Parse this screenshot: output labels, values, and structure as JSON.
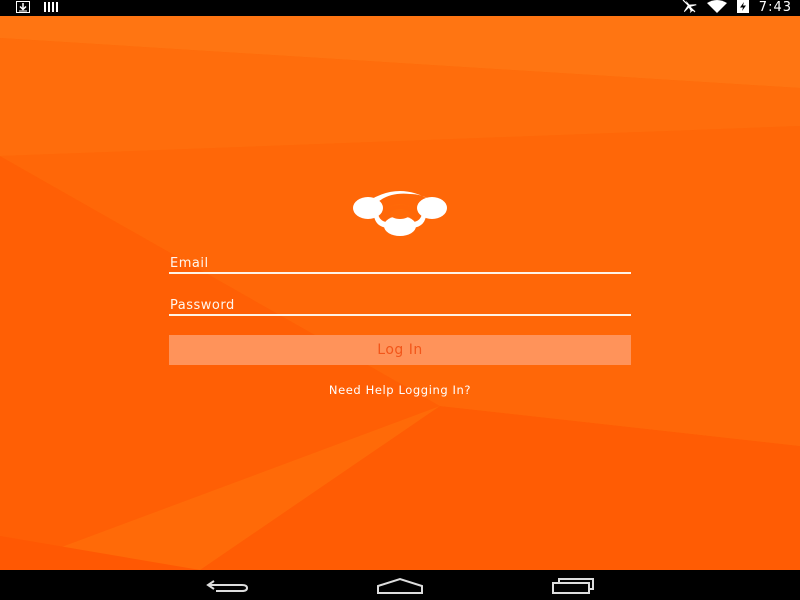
{
  "status_bar": {
    "time": "7:43",
    "left_icons": [
      "download-icon",
      "signal-bars-icon"
    ],
    "right_icons": [
      "airplane-mode-icon",
      "wifi-icon",
      "battery-charging-icon"
    ]
  },
  "login": {
    "logo_icon": "app-logo-icon",
    "email_placeholder": "Email",
    "password_placeholder": "Password",
    "login_label": "Log In",
    "help_label": "Need Help Logging In?"
  },
  "nav_bar": {
    "buttons": [
      "back-icon",
      "home-icon",
      "recents-icon"
    ]
  },
  "colors": {
    "background": "#ff6a08",
    "button_bg": "#ff935a",
    "button_text": "#f2561a",
    "text": "#ffffff"
  }
}
